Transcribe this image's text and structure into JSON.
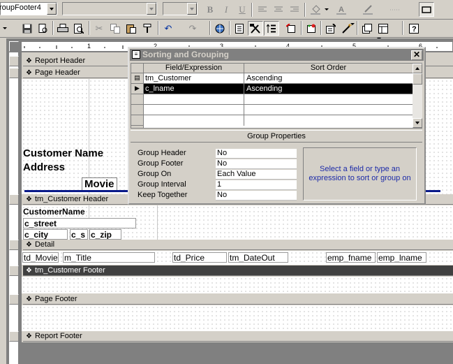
{
  "toolbar1": {
    "object_combo": "roupFooter4",
    "font_combo": "",
    "size_combo": "",
    "format_buttons": {
      "bold": "B",
      "italic": "I",
      "underline": "U"
    }
  },
  "ruler": {
    "marks": [
      "1",
      "2",
      "3",
      "4",
      "5",
      "6"
    ]
  },
  "report": {
    "bands": {
      "report_header": "Report Header",
      "page_header": "Page Header",
      "group_header": "tm_Customer Header",
      "detail": "Detail",
      "group_footer": "tm_Customer Footer",
      "page_footer": "Page Footer",
      "report_footer": "Report Footer"
    },
    "page_header_controls": {
      "customer_name": "Customer Name",
      "address": "Address",
      "movie": "Movie"
    },
    "group_header_controls": {
      "customer_name": "CustomerName",
      "street": "c_street",
      "city": "c_city",
      "state": "c_s",
      "zip": "c_zip"
    },
    "detail_controls": {
      "movie": "td_Movie",
      "title": "m_Title",
      "price": "td_Price",
      "date_out": "tm_DateOut",
      "emp_fname": "emp_fname",
      "emp_lname": "emp_lname"
    }
  },
  "dialog": {
    "title": "Sorting and Grouping",
    "columns": {
      "field": "Field/Expression",
      "sort": "Sort Order"
    },
    "rows": [
      {
        "field": "tm_Customer",
        "sort": "Ascending"
      },
      {
        "field": "c_lname",
        "sort": "Ascending"
      },
      {
        "field": "",
        "sort": ""
      },
      {
        "field": "",
        "sort": ""
      },
      {
        "field": "",
        "sort": ""
      }
    ],
    "group_properties_title": "Group Properties",
    "properties": [
      {
        "label": "Group Header",
        "value": "No"
      },
      {
        "label": "Group Footer",
        "value": "No"
      },
      {
        "label": "Group On",
        "value": "Each Value"
      },
      {
        "label": "Group Interval",
        "value": "1"
      },
      {
        "label": "Keep Together",
        "value": "No"
      }
    ],
    "hint": "Select a field or type an expression to sort or group on",
    "hint_color": "#1c2aa8"
  },
  "colors": {
    "title_bar_inactive": "#808080",
    "selected_row": "#000000",
    "band_selected": "#404040"
  }
}
